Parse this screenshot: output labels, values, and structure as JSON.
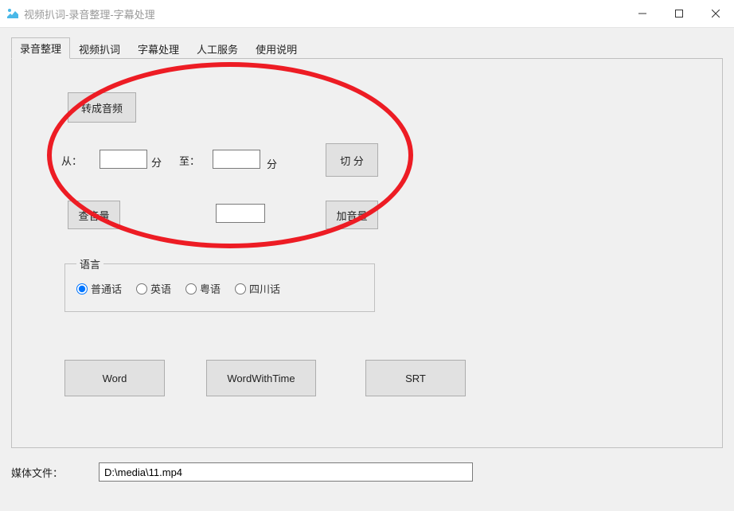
{
  "window": {
    "title": "视频扒词-录音整理-字幕处理"
  },
  "tabs": [
    {
      "label": "录音整理"
    },
    {
      "label": "视频扒词"
    },
    {
      "label": "字幕处理"
    },
    {
      "label": "人工服务"
    },
    {
      "label": "使用说明"
    }
  ],
  "panel": {
    "convert_audio_btn": "转成音频",
    "from_label": "从：",
    "from_value": "",
    "from_unit": "分",
    "to_label": "至：",
    "to_value": "",
    "to_unit": "分",
    "split_btn": "切 分",
    "check_volume_btn": "查音量",
    "mid_input_value": "",
    "add_volume_btn": "加音量",
    "language_legend": "语言",
    "languages": [
      {
        "label": "普通话",
        "checked": true
      },
      {
        "label": "英语",
        "checked": false
      },
      {
        "label": "粤语",
        "checked": false
      },
      {
        "label": "四川话",
        "checked": false
      }
    ],
    "word_btn": "Word",
    "word_time_btn": "WordWithTime",
    "srt_btn": "SRT"
  },
  "media": {
    "label": "媒体文件：",
    "path": "D:\\media\\11.mp4"
  }
}
